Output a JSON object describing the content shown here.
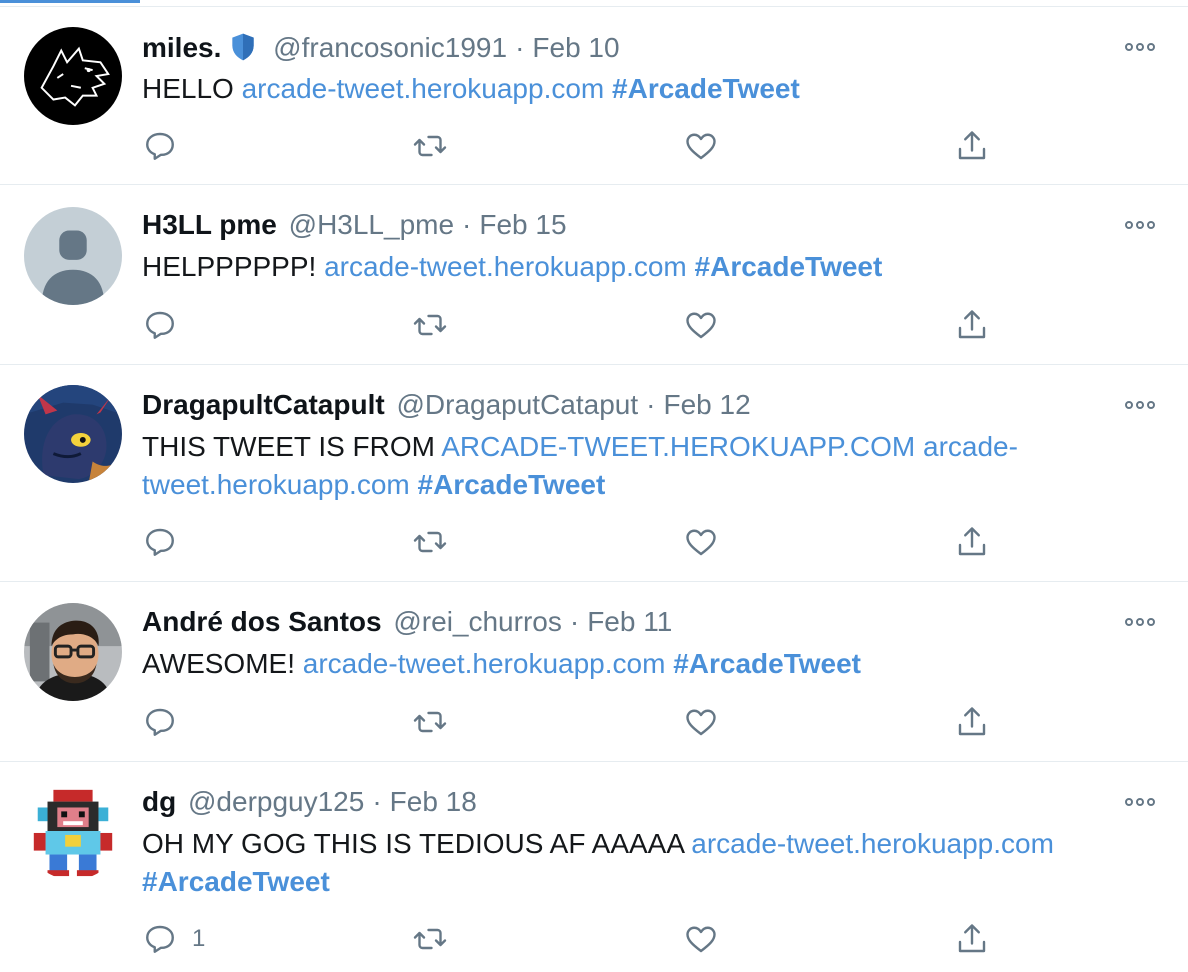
{
  "colors": {
    "accent": "#4a90d9",
    "muted": "#657786",
    "verified_badge": "#4a90d9"
  },
  "tweets": [
    {
      "name": "miles.",
      "verified_badge": true,
      "handle": "@francosonic1991",
      "separator": "·",
      "date": "Feb 10",
      "text_parts": [
        {
          "text": "HELLO ",
          "kind": "plain"
        },
        {
          "text": "arcade-tweet.herokuapp.com",
          "kind": "link"
        },
        {
          "text": " ",
          "kind": "plain"
        },
        {
          "text": "#ArcadeTweet",
          "kind": "tag"
        }
      ],
      "reply_count": "",
      "avatar_icon": "wolf-drawing-avatar"
    },
    {
      "name": "H3LL pme",
      "handle": "@H3LL_pme",
      "separator": "·",
      "date": "Feb 15",
      "text_parts": [
        {
          "text": "HELPPPPPP! ",
          "kind": "plain"
        },
        {
          "text": "arcade-tweet.herokuapp.com",
          "kind": "link"
        },
        {
          "text": " ",
          "kind": "plain"
        },
        {
          "text": "#ArcadeTweet",
          "kind": "tag"
        }
      ],
      "reply_count": "",
      "avatar_icon": "default-person-avatar"
    },
    {
      "name": "DragapultCatapult",
      "handle": "@DragaputCataput",
      "separator": "·",
      "date": "Feb 12",
      "text_parts": [
        {
          "text": "THIS TWEET IS FROM ",
          "kind": "plain"
        },
        {
          "text": "ARCADE-TWEET.HEROKUAPP.COM",
          "kind": "link"
        },
        {
          "text": " ",
          "kind": "plain"
        },
        {
          "text": "arcade-tweet.herokuapp.com",
          "kind": "link"
        },
        {
          "text": " ",
          "kind": "plain"
        },
        {
          "text": "#ArcadeTweet",
          "kind": "tag"
        }
      ],
      "reply_count": "",
      "avatar_icon": "dragon-avatar"
    },
    {
      "name": "André dos Santos",
      "handle": "@rei_churros",
      "separator": "·",
      "date": "Feb 11",
      "text_parts": [
        {
          "text": "AWESOME! ",
          "kind": "plain"
        },
        {
          "text": "arcade-tweet.herokuapp.com",
          "kind": "link"
        },
        {
          "text": " ",
          "kind": "plain"
        },
        {
          "text": "#ArcadeTweet",
          "kind": "tag"
        }
      ],
      "reply_count": "",
      "avatar_icon": "photo-person-avatar"
    },
    {
      "name": "dg",
      "handle": "@derpguy125",
      "separator": "·",
      "date": "Feb 18",
      "text_parts": [
        {
          "text": "OH MY GOG THIS IS TEDIOUS AF AAAAA ",
          "kind": "plain"
        },
        {
          "text": "arcade-tweet.herokuapp.com",
          "kind": "link"
        },
        {
          "text": " ",
          "kind": "plain"
        },
        {
          "text": "#ArcadeTweet",
          "kind": "tag"
        }
      ],
      "reply_count": "1",
      "avatar_icon": "pixel-robot-avatar"
    }
  ],
  "action_icons": [
    "reply-icon",
    "retweet-icon",
    "like-icon",
    "share-icon"
  ]
}
